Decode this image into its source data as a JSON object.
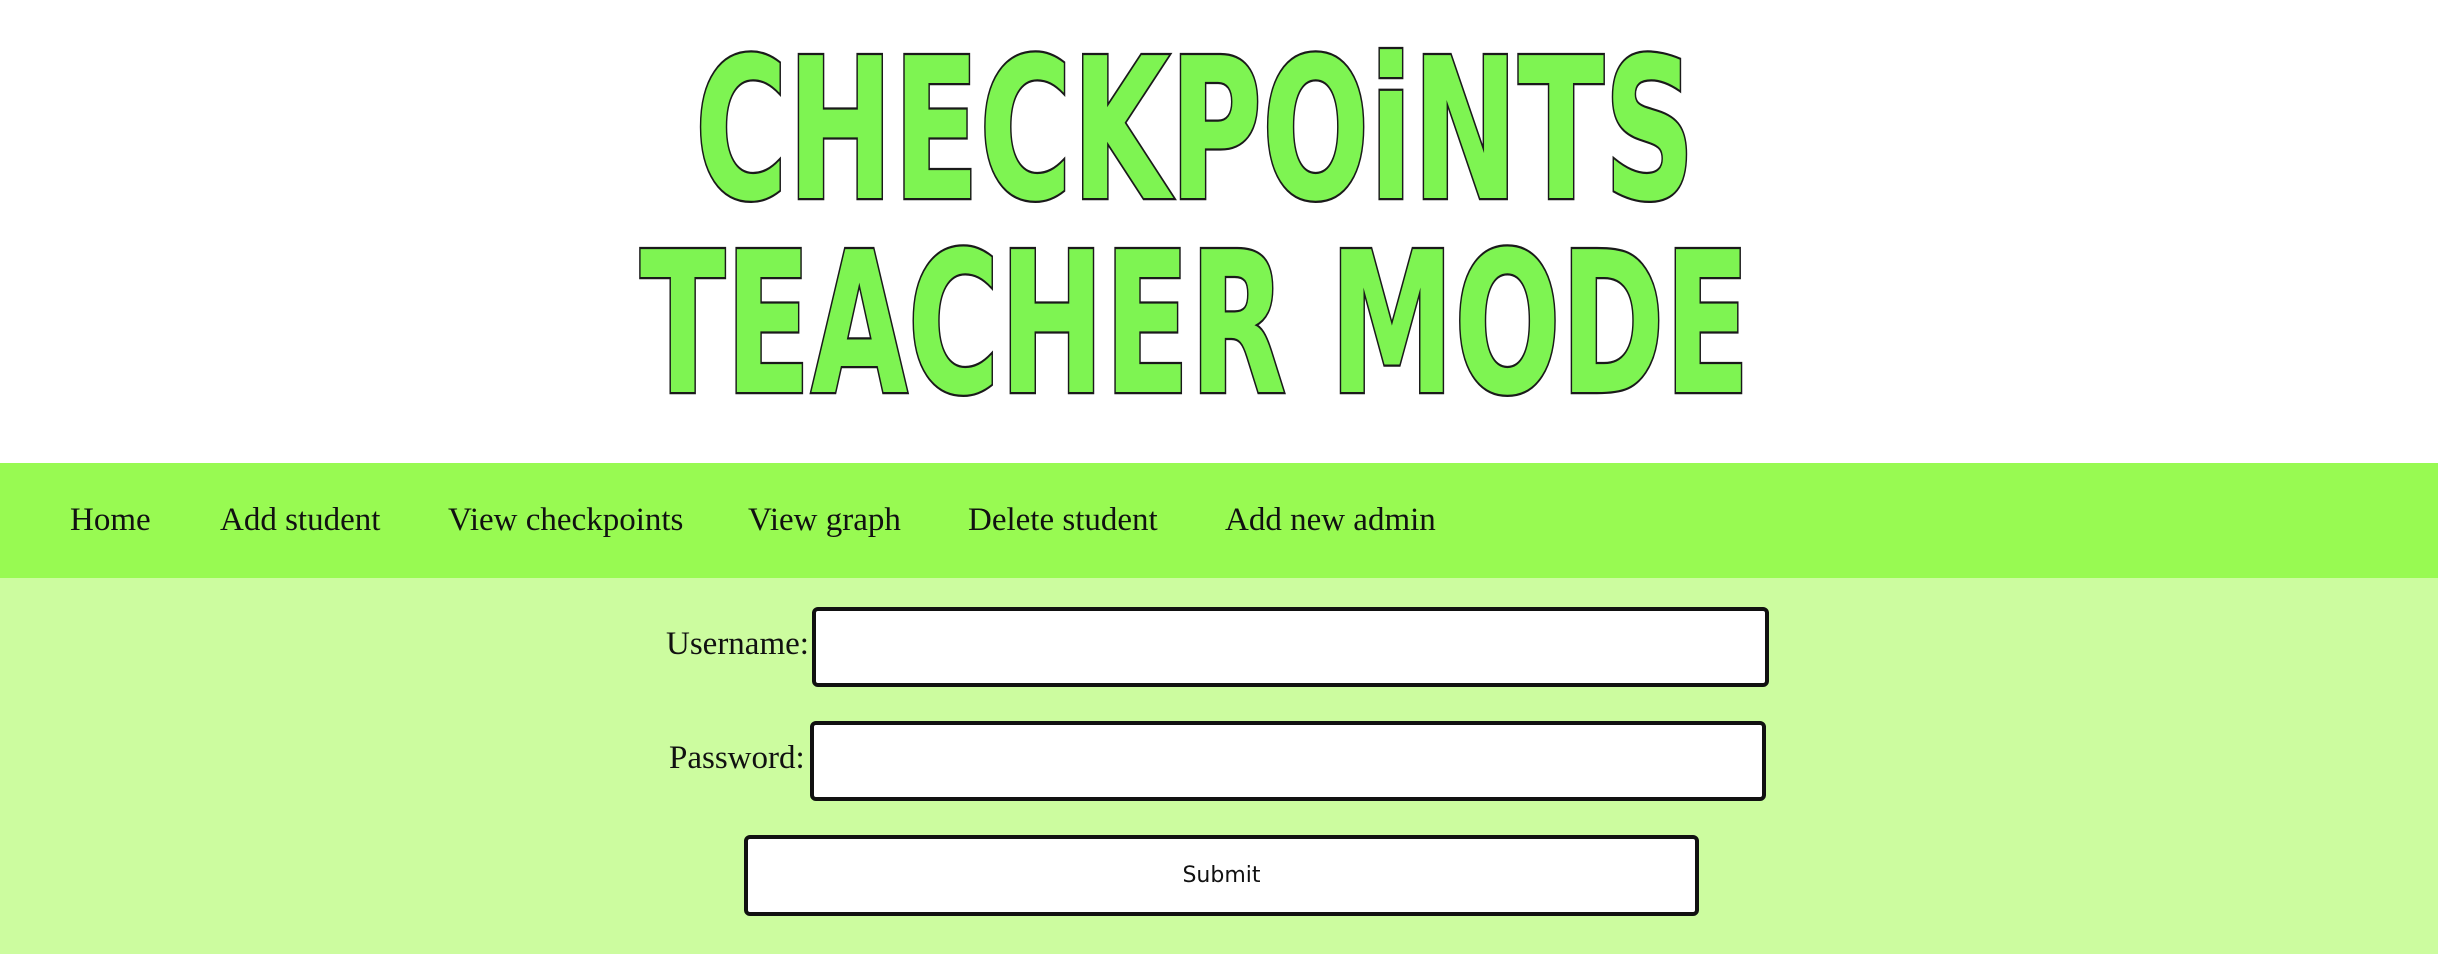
{
  "logo": {
    "line1": "CHECKPOiNTS",
    "line2": "TEACHER MODE",
    "fill_color": "#7ef452",
    "outline_color": "#1a1a1a"
  },
  "nav": {
    "items": [
      {
        "label": "Home"
      },
      {
        "label": "Add student"
      },
      {
        "label": "View checkpoints"
      },
      {
        "label": "View graph"
      },
      {
        "label": "Delete student"
      },
      {
        "label": "Add new admin"
      }
    ]
  },
  "form": {
    "username_label": "Username:",
    "username_value": "",
    "password_label": "Password:",
    "password_value": "",
    "submit_label": "Submit"
  },
  "colors": {
    "banner_bg": "#ffffff",
    "nav_bg": "#98fa52",
    "page_bg": "#ccfc9f"
  }
}
